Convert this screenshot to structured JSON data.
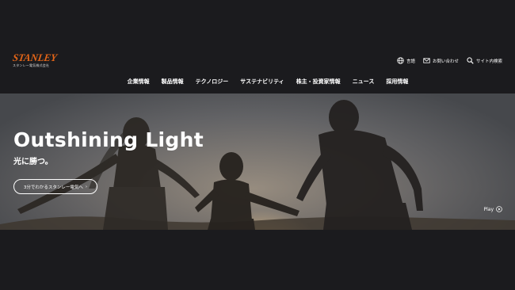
{
  "brand": {
    "logo_text": "STANLEY",
    "logo_sub": "スタンレー電気株式会社"
  },
  "utility": [
    {
      "label": "言語",
      "icon": "globe-icon"
    },
    {
      "label": "お問い合わせ",
      "icon": "mail-icon"
    },
    {
      "label": "サイト内検索",
      "icon": "search-icon"
    }
  ],
  "nav": [
    "企業情報",
    "製品情報",
    "テクノロジー",
    "サステナビリティ",
    "株主・投資家情報",
    "ニュース",
    "採用情報"
  ],
  "hero": {
    "title": "Outshining Light",
    "subtitle": "光に勝つ。",
    "button_label": "3分でわかるスタンレー電気へ",
    "button_arrow": "›",
    "play_label": "Play"
  },
  "colors": {
    "brand": "#e06418",
    "background": "#1b1b1e"
  }
}
